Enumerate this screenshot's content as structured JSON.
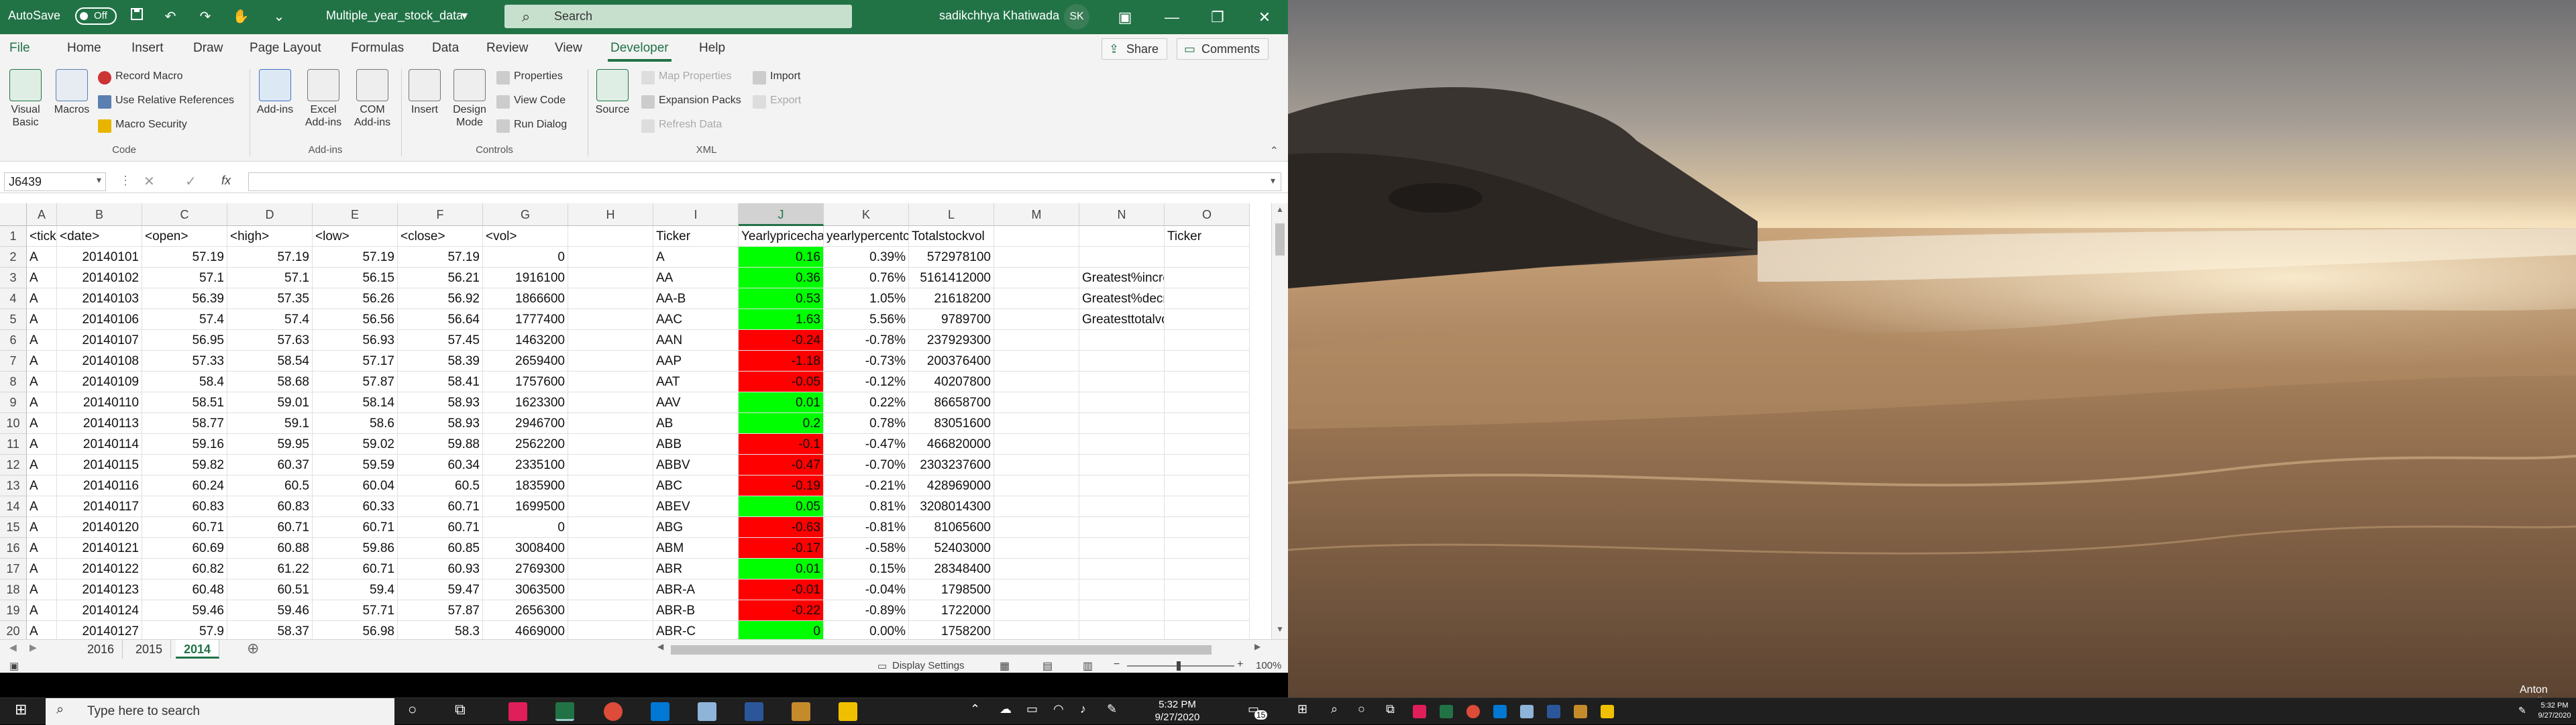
{
  "titlebar": {
    "autosave_label": "AutoSave",
    "autosave_state": "Off",
    "file_name": "Multiple_year_stock_data",
    "search_placeholder": "Search",
    "user_name": "sadikchhya Khatiwada",
    "user_initials": "SK"
  },
  "ribbon_tabs": [
    "File",
    "Home",
    "Insert",
    "Draw",
    "Page Layout",
    "Formulas",
    "Data",
    "Review",
    "View",
    "Developer",
    "Help"
  ],
  "active_tab": "Developer",
  "share_label": "Share",
  "comments_label": "Comments",
  "ribbon": {
    "code": {
      "label": "Code",
      "visual_basic": "Visual Basic",
      "macros": "Macros",
      "record_macro": "Record Macro",
      "relative_refs": "Use Relative References",
      "macro_security": "Macro Security"
    },
    "addins": {
      "label": "Add-ins",
      "add_ins": "Add-ins",
      "excel_addins": "Excel Add-ins",
      "com_addins": "COM Add-ins"
    },
    "controls": {
      "label": "Controls",
      "insert": "Insert",
      "design_mode": "Design Mode",
      "properties": "Properties",
      "view_code": "View Code",
      "run_dialog": "Run Dialog"
    },
    "xml": {
      "label": "XML",
      "source": "Source",
      "map_properties": "Map Properties",
      "expansion_packs": "Expansion Packs",
      "refresh_data": "Refresh Data",
      "import": "Import",
      "export": "Export"
    }
  },
  "formula_bar": {
    "name_box": "J6439",
    "fx_label": "fx",
    "formula": ""
  },
  "columns": [
    "A",
    "B",
    "C",
    "D",
    "E",
    "F",
    "G",
    "H",
    "I",
    "J",
    "K",
    "L",
    "M",
    "N",
    "O"
  ],
  "selected_column": "J",
  "rows": [
    {
      "n": "1",
      "A": "<ticker>",
      "B": "<date>",
      "C": "<open>",
      "D": "<high>",
      "E": "<low>",
      "F": "<close>",
      "G": "<vol>",
      "I": "Ticker",
      "J": "Yearlypricechange",
      "K": "yearlypercentchange",
      "L": "Totalstockvol",
      "N": "",
      "O": "Ticker"
    },
    {
      "n": "2",
      "A": "A",
      "B": "20140101",
      "C": "57.19",
      "D": "57.19",
      "E": "57.19",
      "F": "57.19",
      "G": "0",
      "I": "A",
      "J": "0.16",
      "K": "0.39%",
      "L": "572978100",
      "color": "green"
    },
    {
      "n": "3",
      "A": "A",
      "B": "20140102",
      "C": "57.1",
      "D": "57.1",
      "E": "56.15",
      "F": "56.21",
      "G": "1916100",
      "I": "AA",
      "J": "0.36",
      "K": "0.76%",
      "L": "5161412000",
      "N": "Greatest%increase",
      "color": "green"
    },
    {
      "n": "4",
      "A": "A",
      "B": "20140103",
      "C": "56.39",
      "D": "57.35",
      "E": "56.26",
      "F": "56.92",
      "G": "1866600",
      "I": "AA-B",
      "J": "0.53",
      "K": "1.05%",
      "L": "21618200",
      "N": "Greatest%decrease",
      "color": "green"
    },
    {
      "n": "5",
      "A": "A",
      "B": "20140106",
      "C": "57.4",
      "D": "57.4",
      "E": "56.56",
      "F": "56.64",
      "G": "1777400",
      "I": "AAC",
      "J": "1.63",
      "K": "5.56%",
      "L": "9789700",
      "N": "Greatesttotalvolume",
      "color": "green"
    },
    {
      "n": "6",
      "A": "A",
      "B": "20140107",
      "C": "56.95",
      "D": "57.63",
      "E": "56.93",
      "F": "57.45",
      "G": "1463200",
      "I": "AAN",
      "J": "-0.24",
      "K": "-0.78%",
      "L": "237929300",
      "color": "red"
    },
    {
      "n": "7",
      "A": "A",
      "B": "20140108",
      "C": "57.33",
      "D": "58.54",
      "E": "57.17",
      "F": "58.39",
      "G": "2659400",
      "I": "AAP",
      "J": "-1.18",
      "K": "-0.73%",
      "L": "200376400",
      "color": "red"
    },
    {
      "n": "8",
      "A": "A",
      "B": "20140109",
      "C": "58.4",
      "D": "58.68",
      "E": "57.87",
      "F": "58.41",
      "G": "1757600",
      "I": "AAT",
      "J": "-0.05",
      "K": "-0.12%",
      "L": "40207800",
      "color": "red"
    },
    {
      "n": "9",
      "A": "A",
      "B": "20140110",
      "C": "58.51",
      "D": "59.01",
      "E": "58.14",
      "F": "58.93",
      "G": "1623300",
      "I": "AAV",
      "J": "0.01",
      "K": "0.22%",
      "L": "86658700",
      "color": "green"
    },
    {
      "n": "10",
      "A": "A",
      "B": "20140113",
      "C": "58.77",
      "D": "59.1",
      "E": "58.6",
      "F": "58.93",
      "G": "2946700",
      "I": "AB",
      "J": "0.2",
      "K": "0.78%",
      "L": "83051600",
      "color": "green"
    },
    {
      "n": "11",
      "A": "A",
      "B": "20140114",
      "C": "59.16",
      "D": "59.95",
      "E": "59.02",
      "F": "59.88",
      "G": "2562200",
      "I": "ABB",
      "J": "-0.1",
      "K": "-0.47%",
      "L": "466820000",
      "color": "red"
    },
    {
      "n": "12",
      "A": "A",
      "B": "20140115",
      "C": "59.82",
      "D": "60.37",
      "E": "59.59",
      "F": "60.34",
      "G": "2335100",
      "I": "ABBV",
      "J": "-0.47",
      "K": "-0.70%",
      "L": "2303237600",
      "color": "red"
    },
    {
      "n": "13",
      "A": "A",
      "B": "20140116",
      "C": "60.24",
      "D": "60.5",
      "E": "60.04",
      "F": "60.5",
      "G": "1835900",
      "I": "ABC",
      "J": "-0.19",
      "K": "-0.21%",
      "L": "428969000",
      "color": "red"
    },
    {
      "n": "14",
      "A": "A",
      "B": "20140117",
      "C": "60.83",
      "D": "60.83",
      "E": "60.33",
      "F": "60.71",
      "G": "1699500",
      "I": "ABEV",
      "J": "0.05",
      "K": "0.81%",
      "L": "3208014300",
      "color": "green"
    },
    {
      "n": "15",
      "A": "A",
      "B": "20140120",
      "C": "60.71",
      "D": "60.71",
      "E": "60.71",
      "F": "60.71",
      "G": "0",
      "I": "ABG",
      "J": "-0.63",
      "K": "-0.81%",
      "L": "81065600",
      "color": "red"
    },
    {
      "n": "16",
      "A": "A",
      "B": "20140121",
      "C": "60.69",
      "D": "60.88",
      "E": "59.86",
      "F": "60.85",
      "G": "3008400",
      "I": "ABM",
      "J": "-0.17",
      "K": "-0.58%",
      "L": "52403000",
      "color": "red"
    },
    {
      "n": "17",
      "A": "A",
      "B": "20140122",
      "C": "60.82",
      "D": "61.22",
      "E": "60.71",
      "F": "60.93",
      "G": "2769300",
      "I": "ABR",
      "J": "0.01",
      "K": "0.15%",
      "L": "28348400",
      "color": "green"
    },
    {
      "n": "18",
      "A": "A",
      "B": "20140123",
      "C": "60.48",
      "D": "60.51",
      "E": "59.4",
      "F": "59.47",
      "G": "3063500",
      "I": "ABR-A",
      "J": "-0.01",
      "K": "-0.04%",
      "L": "1798500",
      "color": "red"
    },
    {
      "n": "19",
      "A": "A",
      "B": "20140124",
      "C": "59.46",
      "D": "59.46",
      "E": "57.71",
      "F": "57.87",
      "G": "2656300",
      "I": "ABR-B",
      "J": "-0.22",
      "K": "-0.89%",
      "L": "1722000",
      "color": "red"
    },
    {
      "n": "20",
      "A": "A",
      "B": "20140127",
      "C": "57.9",
      "D": "58.37",
      "E": "56.98",
      "F": "58.3",
      "G": "4669000",
      "I": "ABR-C",
      "J": "0",
      "K": "0.00%",
      "L": "1758200",
      "color": "green"
    }
  ],
  "sheet_tabs": [
    "2016",
    "2015",
    "2014"
  ],
  "active_sheet": "2014",
  "status": {
    "display_settings": "Display Settings",
    "zoom": "100%"
  },
  "desktop": {
    "credit": "Anton Gorlin"
  },
  "taskbar": {
    "search_placeholder": "Type here to search",
    "time": "5:32 PM",
    "date": "9/27/2020",
    "notification_count": "15",
    "right_time": "5:32 PM",
    "right_date": "9/27/2020"
  },
  "colors": {
    "excel_green": "#217346",
    "positive": "#00ff00",
    "negative": "#ff0000"
  }
}
